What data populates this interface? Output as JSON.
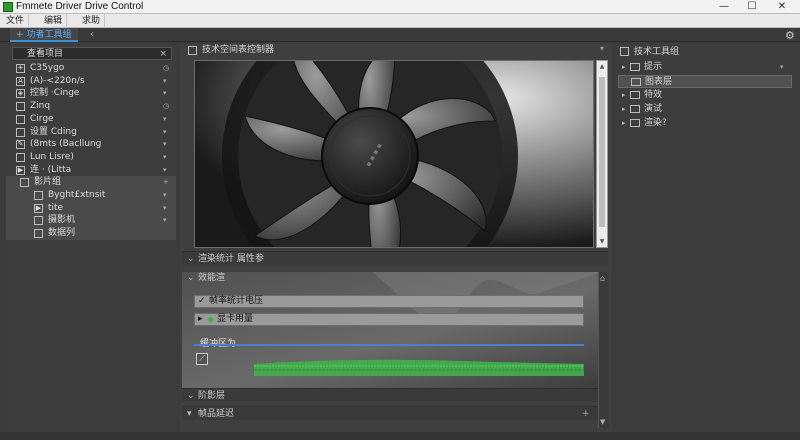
{
  "window": {
    "title": "Fmmete Driver Drive Control",
    "minimize_icon": "—",
    "maximize_icon": "☐",
    "close_icon": "✕"
  },
  "menu": {
    "items": [
      {
        "label": "文件"
      },
      {
        "label": "编辑"
      },
      {
        "label": "求助"
      }
    ]
  },
  "tabbar": {
    "active_tab": "功者工具组",
    "chevron": "‹"
  },
  "left": {
    "search_text": "查看项目",
    "close": "×",
    "items": [
      {
        "label": "C35ygo",
        "icon": "brightness-icon",
        "glyph": "☀",
        "right": "◷"
      },
      {
        "label": "(A)-<220n/s",
        "icon": "sun-icon",
        "glyph": "A",
        "right": "▾"
      },
      {
        "label": "控制 ·Cinge",
        "icon": "eye-icon",
        "glyph": "◈",
        "right": "▾"
      },
      {
        "label": "Zinq",
        "icon": "square-icon",
        "glyph": "",
        "right": "◷"
      },
      {
        "label": "Cirge",
        "icon": "checkbox-icon",
        "glyph": "",
        "right": "▾"
      },
      {
        "label": "设置 Cding",
        "icon": "checkbox-icon",
        "glyph": "",
        "right": "▾"
      },
      {
        "label": "(8mts (Bacllung",
        "icon": "brush-icon",
        "glyph": "✎",
        "right": "▾"
      },
      {
        "label": "Lun Lisre)",
        "icon": "grid-icon",
        "glyph": "",
        "right": "▾"
      },
      {
        "label": "连 · (Litta",
        "icon": "play-icon",
        "glyph": "▶",
        "right": "▾"
      },
      {
        "label": "影片组",
        "icon": "image-icon",
        "glyph": "",
        "right": "+"
      },
      {
        "label": "Byght£xtnsit",
        "icon": "image-icon",
        "glyph": "",
        "right": "▾"
      },
      {
        "label": "tite",
        "icon": "play-icon",
        "glyph": "▶",
        "right": "▾"
      },
      {
        "label": "摄影机",
        "icon": "monitor-icon",
        "glyph": "",
        "right": "▾"
      },
      {
        "label": "数据列",
        "icon": "none",
        "glyph": "",
        "right": ""
      }
    ]
  },
  "center": {
    "header": "技术空间表控制器",
    "pin_icon": "▾",
    "section_settings": "渲染统计 属性参",
    "section_perf": "效能渲",
    "perf_row1": "帧率统计电压",
    "perf_row2": "显卡用量",
    "perf_row3": "缓冲区为",
    "section_a": "阶影层",
    "section_b": "帧品延迟",
    "home_icon": "⌂"
  },
  "right": {
    "header": "技术工具组",
    "items": [
      {
        "label": "提示",
        "arrow": "▸",
        "right": "▾"
      },
      {
        "label": "图表层",
        "arrow": "",
        "right": ""
      },
      {
        "label": "特效",
        "arrow": "▸",
        "right": ""
      },
      {
        "label": "演试",
        "arrow": "▸",
        "right": ""
      },
      {
        "label": "渲染?",
        "arrow": "▸",
        "right": ""
      }
    ]
  },
  "colors": {
    "accent": "#3a8fd6",
    "graph_green": "#3fb34a",
    "graph_blue": "#4a80c8"
  }
}
